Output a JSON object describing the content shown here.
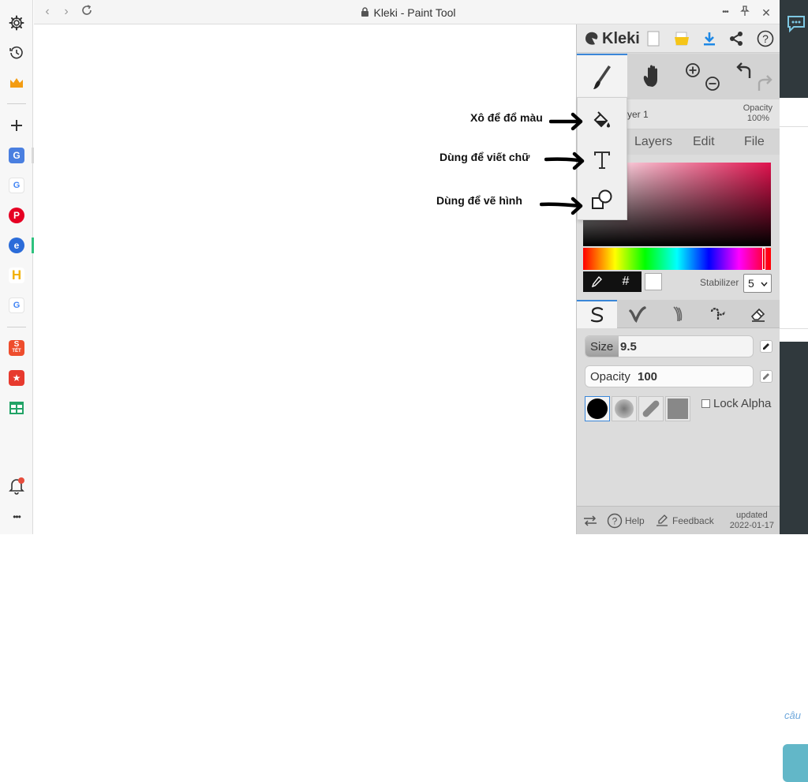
{
  "browser": {
    "title": "Kleki - Paint Tool",
    "menu_glyph": "•••",
    "pin_glyph": "⌖",
    "close_glyph": "✕"
  },
  "sidebar": {
    "favicons": [
      {
        "name": "google-translate",
        "glyph": "G",
        "color": "#4a7fe0"
      },
      {
        "name": "google",
        "glyph": "G",
        "color": "#4285f4"
      },
      {
        "name": "pinterest",
        "glyph": "P",
        "color": "#e60023"
      },
      {
        "name": "coc-coc",
        "glyph": "e",
        "color": "#2b6cd9"
      },
      {
        "name": "h-app",
        "glyph": "H",
        "color": "#f2b100"
      },
      {
        "name": "google-2",
        "glyph": "G",
        "color": "#4285f4"
      },
      {
        "name": "shopee-tet",
        "glyph": "S",
        "color": "#ee4d2d",
        "sub": "TẾT"
      },
      {
        "name": "shopee-sale",
        "glyph": "★",
        "color": "#e73a2e"
      },
      {
        "name": "sheets",
        "glyph": "",
        "color": "#21a366"
      }
    ],
    "more_glyph": "•••"
  },
  "kleki": {
    "logo_text": "Kleki",
    "layer": {
      "name_partial": "yer 1",
      "opacity_label": "Opacity",
      "opacity_value": "100%"
    },
    "tabs": [
      "Layers",
      "Edit",
      "File"
    ],
    "color": {
      "hex_symbol": "#",
      "stabilizer_label": "Stabilizer",
      "stabilizer_value": "5",
      "primary": "#000000",
      "secondary": "#ffffff"
    },
    "brush": {
      "size_label": "Size",
      "size_value": "9.5",
      "size_fraction": 0.2,
      "opacity_label": "Opacity",
      "opacity_value": "100",
      "lock_alpha_label": "Lock Alpha"
    },
    "footer": {
      "help_label": "Help",
      "feedback_label": "Feedback",
      "updated_label": "updated",
      "updated_date": "2022-01-17"
    }
  },
  "annotations": {
    "fill": "Xô để đổ màu",
    "text": "Dùng để viết chữ",
    "shape": "Dùng để vẽ hình"
  },
  "rightstrip": {
    "partial_text": "câu"
  }
}
